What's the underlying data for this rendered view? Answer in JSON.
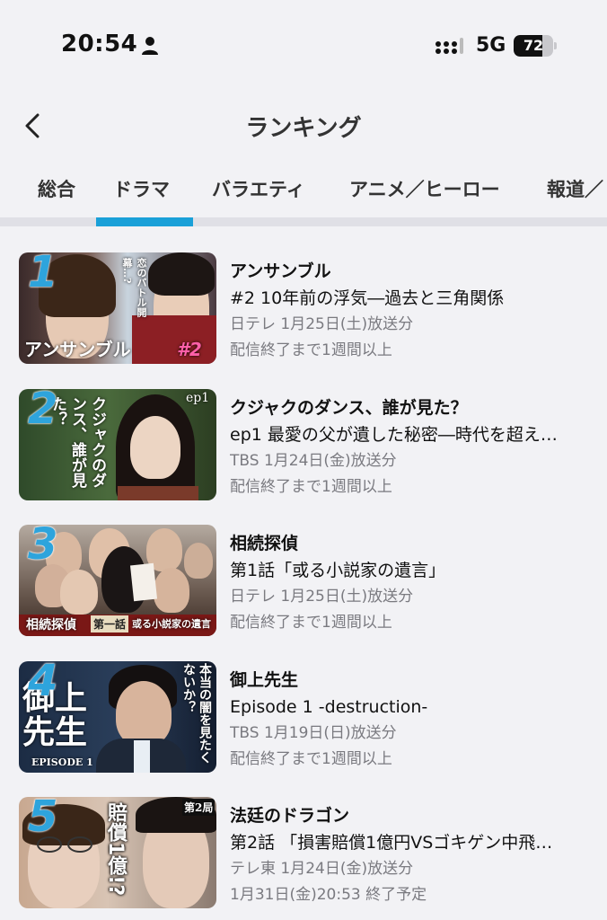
{
  "status_bar": {
    "time": "20:54",
    "network": "5G",
    "battery_level": "72",
    "battery_fraction": 0.72
  },
  "nav": {
    "title": "ランキング",
    "back_icon": "chevron-left-icon"
  },
  "tabs": [
    {
      "label": "総合",
      "active": false
    },
    {
      "label": "ドラマ",
      "active": true
    },
    {
      "label": "バラエティ",
      "active": false
    },
    {
      "label": "アニメ／ヒーロー",
      "active": false
    },
    {
      "label": "報道／",
      "active": false
    }
  ],
  "colors": {
    "accent": "#1aa0d8",
    "rank_number": "#2ea4dc",
    "background": "#f2f2f5"
  },
  "items": [
    {
      "rank": "1",
      "title": "アンサンブル",
      "episode": "#2 10年前の浮気―過去と三角関係",
      "broadcast": "日テレ 1月25日(土)放送分",
      "availability": "配信終了まで1週間以上",
      "thumb_texts": [
        "アンサンブル",
        "#2",
        "恋のバトル開幕…?"
      ]
    },
    {
      "rank": "2",
      "title": "クジャクのダンス、誰が見た？",
      "episode": "ep1 最愛の父が遺した秘密―時代を超え…",
      "broadcast": "TBS 1月24日(金)放送分",
      "availability": "配信終了まで1週間以上",
      "thumb_texts": [
        "クジャクのダンス、誰が見た？",
        "ep1"
      ]
    },
    {
      "rank": "3",
      "title": "相続探偵",
      "episode": "第1話「或る小説家の遺言」",
      "broadcast": "日テレ 1月25日(土)放送分",
      "availability": "配信終了まで1週間以上",
      "thumb_texts": [
        "相続探偵",
        "第一話",
        "或る小説家の遺言"
      ]
    },
    {
      "rank": "4",
      "title": "御上先生",
      "episode": "Episode 1 -destruction-",
      "broadcast": "TBS 1月19日(日)放送分",
      "availability": "配信終了まで1週間以上",
      "thumb_texts": [
        "御上先生",
        "EPISODE 1",
        "本当の闇を見たくないか？"
      ]
    },
    {
      "rank": "5",
      "title": "法廷のドラゴン",
      "episode": "第2話 「損害賠償1億円VSゴキゲン中飛…",
      "broadcast": "テレ東 1月24日(金)放送分",
      "availability": "1月31日(金)20:53 終了予定",
      "thumb_texts": [
        "賠償1億!?",
        "第2局"
      ]
    }
  ]
}
